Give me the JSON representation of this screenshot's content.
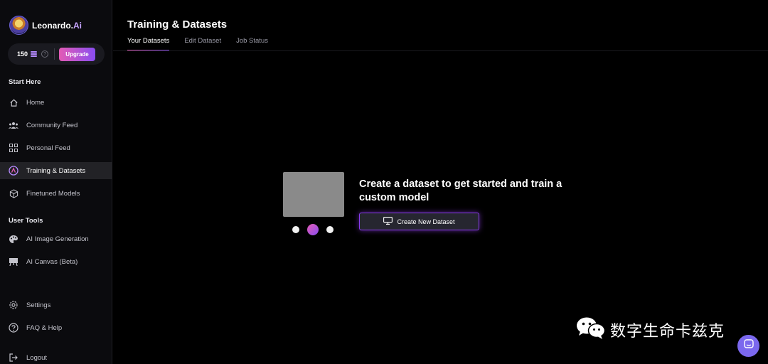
{
  "brand": {
    "name": "Leonardo.",
    "suffix": "Ai"
  },
  "credits": {
    "count": "150",
    "upgrade_label": "Upgrade",
    "help_glyph": "?"
  },
  "sidebar": {
    "start_title": "Start Here",
    "start_items": [
      {
        "label": "Home",
        "icon": "home-icon"
      },
      {
        "label": "Community Feed",
        "icon": "community-icon"
      },
      {
        "label": "Personal Feed",
        "icon": "grid-icon"
      },
      {
        "label": "Training & Datasets",
        "icon": "training-icon",
        "active": true
      },
      {
        "label": "Finetuned Models",
        "icon": "cube-icon"
      }
    ],
    "tools_title": "User Tools",
    "tool_items": [
      {
        "label": "AI Image Generation",
        "icon": "palette-icon"
      },
      {
        "label": "AI Canvas (Beta)",
        "icon": "easel-icon"
      }
    ],
    "bottom_items": [
      {
        "label": "Settings",
        "icon": "gear-icon"
      },
      {
        "label": "FAQ & Help",
        "icon": "help-icon"
      },
      {
        "label": "Logout",
        "icon": "logout-icon"
      }
    ]
  },
  "page": {
    "title": "Training & Datasets",
    "tabs": [
      {
        "label": "Your Datasets",
        "active": true
      },
      {
        "label": "Edit Dataset"
      },
      {
        "label": "Job Status"
      }
    ]
  },
  "empty_state": {
    "heading": "Create a dataset to get started and train a custom model",
    "button_label": "Create New Dataset"
  },
  "watermark": {
    "text": "数字生命卡兹克"
  },
  "colors": {
    "accent_pink": "#e35bb5",
    "accent_purple": "#8a4df0",
    "chat_bubble": "#7b68ee"
  }
}
